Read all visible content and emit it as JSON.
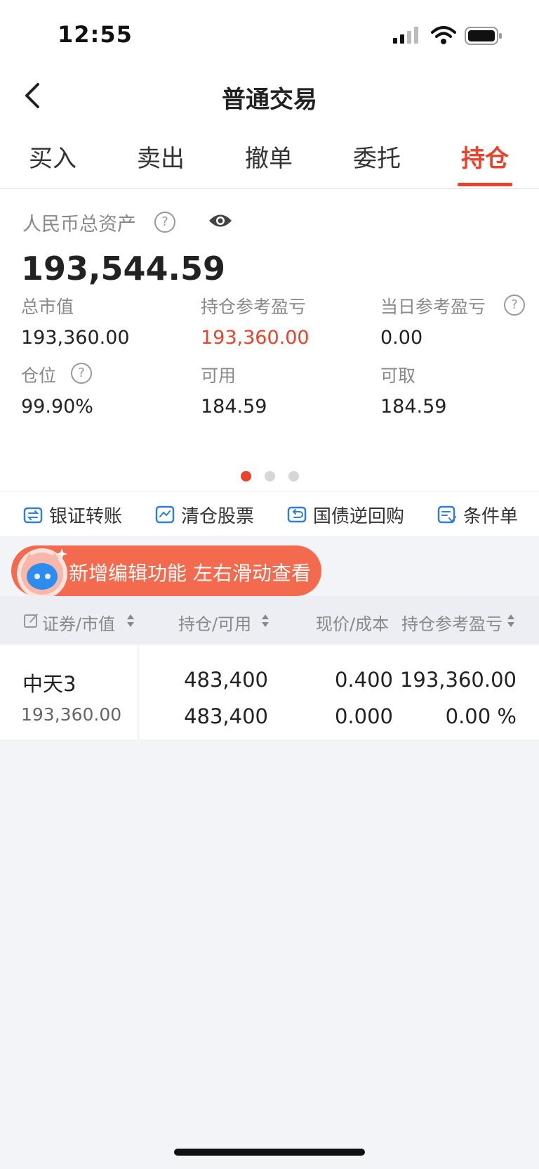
{
  "status": {
    "time": "12:55"
  },
  "header": {
    "title": "普通交易",
    "tabs": [
      {
        "label": "买入"
      },
      {
        "label": "卖出"
      },
      {
        "label": "撤单"
      },
      {
        "label": "委托"
      },
      {
        "label": "持仓"
      }
    ],
    "active_tab": "持仓"
  },
  "assets": {
    "total_label": "人民币总资产",
    "total_value": "193,544.59",
    "items": [
      {
        "label": "总市值",
        "value": "193,360.00"
      },
      {
        "label": "持仓参考盈亏",
        "value": "193,360.00"
      },
      {
        "label": "当日参考盈亏",
        "value": "0.00"
      },
      {
        "label": "仓位",
        "value": "99.90%"
      },
      {
        "label": "可用",
        "value": "184.59"
      },
      {
        "label": "可取",
        "value": "184.59"
      }
    ]
  },
  "carousel": {
    "pages": 3,
    "active": 1
  },
  "toolbar": [
    {
      "label": "银证转账",
      "icon": "transfer-icon"
    },
    {
      "label": "清仓股票",
      "icon": "clear-stock-icon"
    },
    {
      "label": "国债逆回购",
      "icon": "repo-icon"
    },
    {
      "label": "条件单",
      "icon": "condition-order-icon"
    }
  ],
  "promo": {
    "text": "新增编辑功能 左右滑动查看"
  },
  "table": {
    "headers": [
      "证券/市值",
      "持仓/可用",
      "现价/成本",
      "持仓参考盈亏"
    ],
    "rows": [
      {
        "name": "中天3",
        "market_value": "193,360.00",
        "position": "483,400",
        "available": "483,400",
        "price": "0.400",
        "cost": "0.000",
        "pl": "193,360.00",
        "pl_pct": "0.00 %"
      }
    ]
  },
  "colors": {
    "accent": "#e8432b",
    "icon_blue": "#2f7fd6",
    "background": "#f3f4f8"
  }
}
